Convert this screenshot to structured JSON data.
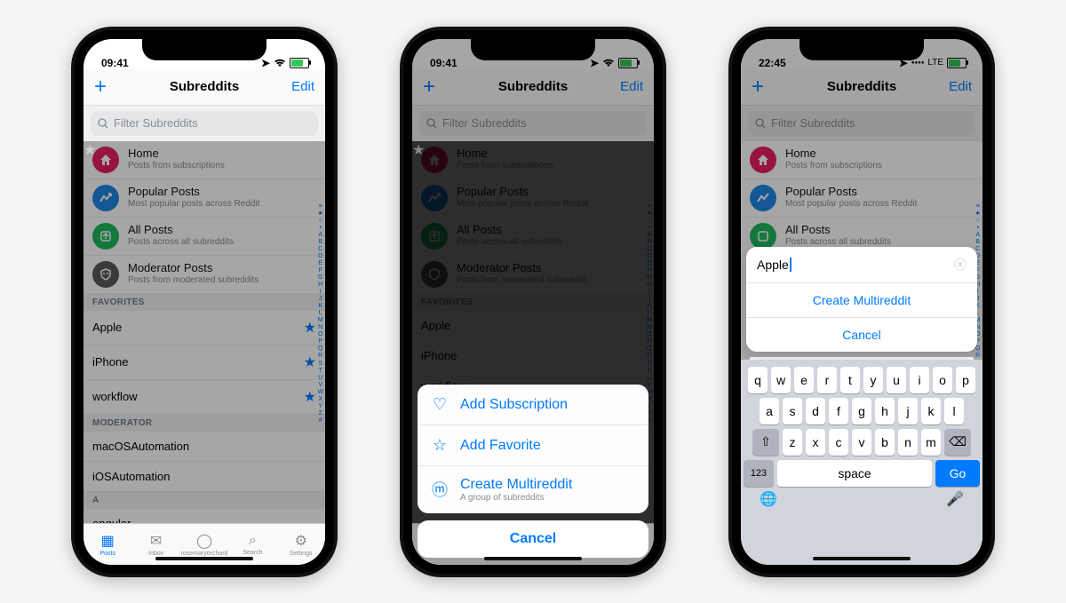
{
  "time_a": "09:41",
  "time_c": "22:45",
  "lte": "LTE",
  "nav": {
    "title": "Subreddits",
    "add": "+",
    "edit": "Edit"
  },
  "search": {
    "ph": "Filter Subreddits"
  },
  "rows": [
    {
      "title": "Home",
      "sub": "Posts from subscriptions",
      "color": "#e91e63"
    },
    {
      "title": "Popular Posts",
      "sub": "Most popular posts across Reddit",
      "color": "#1e88e5"
    },
    {
      "title": "All Posts",
      "sub": "Posts across all subreddits",
      "color": "#20b85c"
    },
    {
      "title": "Moderator Posts",
      "sub": "Posts from moderated subreddits",
      "color": "#5a5a5a"
    }
  ],
  "sections": {
    "fav": "FAVORITES",
    "mod": "MODERATOR",
    "a": "A"
  },
  "favs": [
    "Apple",
    "iPhone",
    "workflow"
  ],
  "mods": [
    "macOSAutomation",
    "iOSAutomation"
  ],
  "a_items": [
    "angular"
  ],
  "tabs": [
    "Posts",
    "Inbox",
    "rosemaryorchard",
    "Search",
    "Settings"
  ],
  "index": [
    "≡",
    "★",
    "○",
    "•",
    "A",
    "B",
    "C",
    "D",
    "E",
    "F",
    "G",
    "H",
    "I",
    "J",
    "K",
    "L",
    "M",
    "N",
    "O",
    "P",
    "Q",
    "R",
    "S",
    "T",
    "U",
    "V",
    "W",
    "X",
    "Y",
    "Z",
    "#"
  ],
  "sheet": {
    "rows": [
      {
        "label": "Add Subscription"
      },
      {
        "label": "Add Favorite"
      },
      {
        "label": "Create Multireddit",
        "sub": "A group of subreddits"
      }
    ],
    "cancel": "Cancel"
  },
  "p3": {
    "input": "Apple",
    "create": "Create Multireddit",
    "cancel": "Cancel"
  },
  "kb": {
    "r1": [
      "q",
      "w",
      "e",
      "r",
      "t",
      "y",
      "u",
      "i",
      "o",
      "p"
    ],
    "r2": [
      "a",
      "s",
      "d",
      "f",
      "g",
      "h",
      "j",
      "k",
      "l"
    ],
    "r3": [
      "z",
      "x",
      "c",
      "v",
      "b",
      "n",
      "m"
    ],
    "num": "123",
    "space": "space",
    "go": "Go"
  }
}
